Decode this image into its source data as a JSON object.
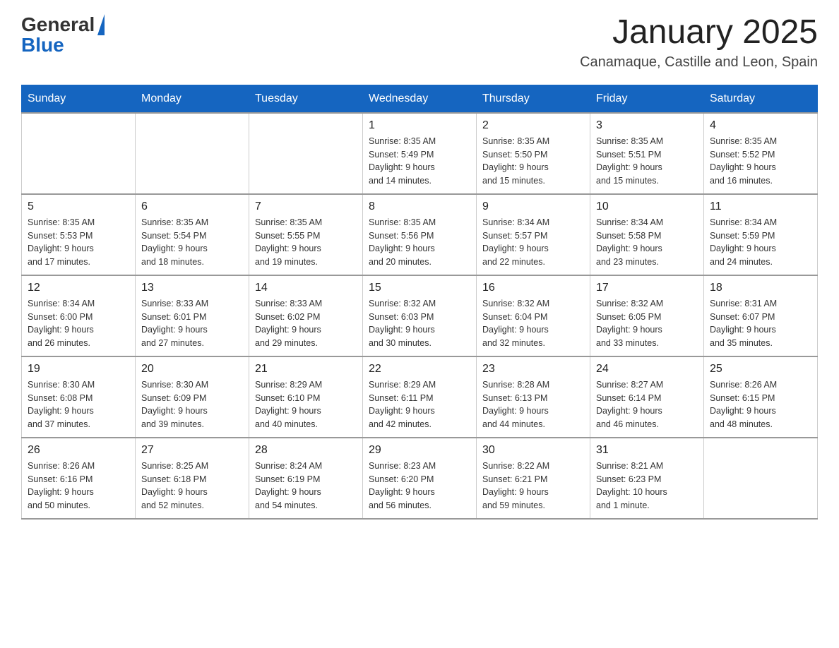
{
  "logo": {
    "general": "General",
    "blue": "Blue"
  },
  "header": {
    "title": "January 2025",
    "location": "Canamaque, Castille and Leon, Spain"
  },
  "weekdays": [
    "Sunday",
    "Monday",
    "Tuesday",
    "Wednesday",
    "Thursday",
    "Friday",
    "Saturday"
  ],
  "weeks": [
    [
      {
        "day": "",
        "info": ""
      },
      {
        "day": "",
        "info": ""
      },
      {
        "day": "",
        "info": ""
      },
      {
        "day": "1",
        "info": "Sunrise: 8:35 AM\nSunset: 5:49 PM\nDaylight: 9 hours\nand 14 minutes."
      },
      {
        "day": "2",
        "info": "Sunrise: 8:35 AM\nSunset: 5:50 PM\nDaylight: 9 hours\nand 15 minutes."
      },
      {
        "day": "3",
        "info": "Sunrise: 8:35 AM\nSunset: 5:51 PM\nDaylight: 9 hours\nand 15 minutes."
      },
      {
        "day": "4",
        "info": "Sunrise: 8:35 AM\nSunset: 5:52 PM\nDaylight: 9 hours\nand 16 minutes."
      }
    ],
    [
      {
        "day": "5",
        "info": "Sunrise: 8:35 AM\nSunset: 5:53 PM\nDaylight: 9 hours\nand 17 minutes."
      },
      {
        "day": "6",
        "info": "Sunrise: 8:35 AM\nSunset: 5:54 PM\nDaylight: 9 hours\nand 18 minutes."
      },
      {
        "day": "7",
        "info": "Sunrise: 8:35 AM\nSunset: 5:55 PM\nDaylight: 9 hours\nand 19 minutes."
      },
      {
        "day": "8",
        "info": "Sunrise: 8:35 AM\nSunset: 5:56 PM\nDaylight: 9 hours\nand 20 minutes."
      },
      {
        "day": "9",
        "info": "Sunrise: 8:34 AM\nSunset: 5:57 PM\nDaylight: 9 hours\nand 22 minutes."
      },
      {
        "day": "10",
        "info": "Sunrise: 8:34 AM\nSunset: 5:58 PM\nDaylight: 9 hours\nand 23 minutes."
      },
      {
        "day": "11",
        "info": "Sunrise: 8:34 AM\nSunset: 5:59 PM\nDaylight: 9 hours\nand 24 minutes."
      }
    ],
    [
      {
        "day": "12",
        "info": "Sunrise: 8:34 AM\nSunset: 6:00 PM\nDaylight: 9 hours\nand 26 minutes."
      },
      {
        "day": "13",
        "info": "Sunrise: 8:33 AM\nSunset: 6:01 PM\nDaylight: 9 hours\nand 27 minutes."
      },
      {
        "day": "14",
        "info": "Sunrise: 8:33 AM\nSunset: 6:02 PM\nDaylight: 9 hours\nand 29 minutes."
      },
      {
        "day": "15",
        "info": "Sunrise: 8:32 AM\nSunset: 6:03 PM\nDaylight: 9 hours\nand 30 minutes."
      },
      {
        "day": "16",
        "info": "Sunrise: 8:32 AM\nSunset: 6:04 PM\nDaylight: 9 hours\nand 32 minutes."
      },
      {
        "day": "17",
        "info": "Sunrise: 8:32 AM\nSunset: 6:05 PM\nDaylight: 9 hours\nand 33 minutes."
      },
      {
        "day": "18",
        "info": "Sunrise: 8:31 AM\nSunset: 6:07 PM\nDaylight: 9 hours\nand 35 minutes."
      }
    ],
    [
      {
        "day": "19",
        "info": "Sunrise: 8:30 AM\nSunset: 6:08 PM\nDaylight: 9 hours\nand 37 minutes."
      },
      {
        "day": "20",
        "info": "Sunrise: 8:30 AM\nSunset: 6:09 PM\nDaylight: 9 hours\nand 39 minutes."
      },
      {
        "day": "21",
        "info": "Sunrise: 8:29 AM\nSunset: 6:10 PM\nDaylight: 9 hours\nand 40 minutes."
      },
      {
        "day": "22",
        "info": "Sunrise: 8:29 AM\nSunset: 6:11 PM\nDaylight: 9 hours\nand 42 minutes."
      },
      {
        "day": "23",
        "info": "Sunrise: 8:28 AM\nSunset: 6:13 PM\nDaylight: 9 hours\nand 44 minutes."
      },
      {
        "day": "24",
        "info": "Sunrise: 8:27 AM\nSunset: 6:14 PM\nDaylight: 9 hours\nand 46 minutes."
      },
      {
        "day": "25",
        "info": "Sunrise: 8:26 AM\nSunset: 6:15 PM\nDaylight: 9 hours\nand 48 minutes."
      }
    ],
    [
      {
        "day": "26",
        "info": "Sunrise: 8:26 AM\nSunset: 6:16 PM\nDaylight: 9 hours\nand 50 minutes."
      },
      {
        "day": "27",
        "info": "Sunrise: 8:25 AM\nSunset: 6:18 PM\nDaylight: 9 hours\nand 52 minutes."
      },
      {
        "day": "28",
        "info": "Sunrise: 8:24 AM\nSunset: 6:19 PM\nDaylight: 9 hours\nand 54 minutes."
      },
      {
        "day": "29",
        "info": "Sunrise: 8:23 AM\nSunset: 6:20 PM\nDaylight: 9 hours\nand 56 minutes."
      },
      {
        "day": "30",
        "info": "Sunrise: 8:22 AM\nSunset: 6:21 PM\nDaylight: 9 hours\nand 59 minutes."
      },
      {
        "day": "31",
        "info": "Sunrise: 8:21 AM\nSunset: 6:23 PM\nDaylight: 10 hours\nand 1 minute."
      },
      {
        "day": "",
        "info": ""
      }
    ]
  ]
}
